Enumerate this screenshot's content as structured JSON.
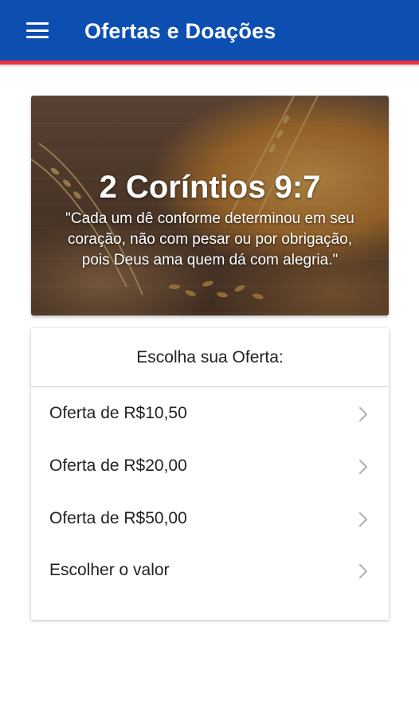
{
  "app_bar": {
    "title": "Ofertas e Doações",
    "menu_icon": "menu-icon",
    "color": "#0d4fb0",
    "stripe_color": "#e9313a"
  },
  "hero": {
    "reference": "2 Coríntios 9:7",
    "quote_lines": [
      "\"Cada um dê conforme determinou em seu",
      "coração, não com pesar ou por obrigação,",
      "pois Deus ama quem dá com alegria.\""
    ]
  },
  "offers": {
    "header": "Escolha sua Oferta:",
    "items": [
      {
        "label": "Oferta de R$10,50",
        "icon": "chevron-right-icon"
      },
      {
        "label": "Oferta de R$20,00",
        "icon": "chevron-right-icon"
      },
      {
        "label": "Oferta de R$50,00",
        "icon": "chevron-right-icon"
      },
      {
        "label": "Escolher o valor",
        "icon": "chevron-right-icon"
      }
    ]
  }
}
